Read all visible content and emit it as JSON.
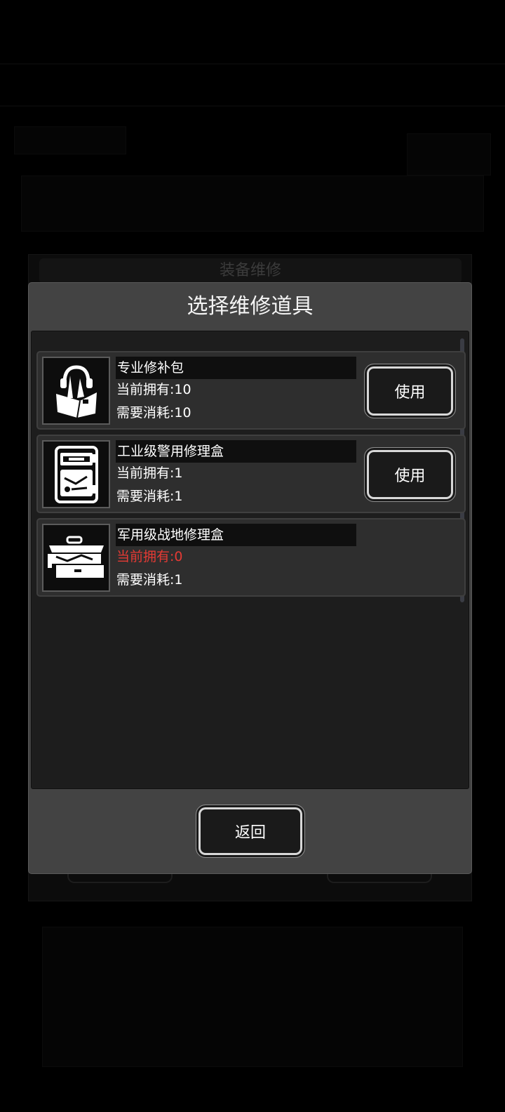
{
  "background": {
    "dialog_title": "装备维修"
  },
  "modal": {
    "title": "选择维修道具",
    "back_label": "返回"
  },
  "items": [
    {
      "name": "专业修补包",
      "owned": "当前拥有:10",
      "cost": "需要消耗:10",
      "button": "使用",
      "icon": "repair-kit-bag-icon",
      "sufficient": true
    },
    {
      "name": "工业级警用修理盒",
      "owned": "当前拥有:1",
      "cost": "需要消耗:1",
      "button": "使用",
      "icon": "toolbox-case-icon",
      "sufficient": true
    },
    {
      "name": "军用级战地修理盒",
      "owned": "当前拥有:0",
      "cost": "需要消耗:1",
      "icon": "field-tool-chest-icon",
      "sufficient": false
    }
  ],
  "colors": {
    "insufficient_text": "#e43a34",
    "modal_bg": "#434343",
    "panel_bg": "#1d1d1d",
    "item_bg": "#2e2e2e"
  }
}
